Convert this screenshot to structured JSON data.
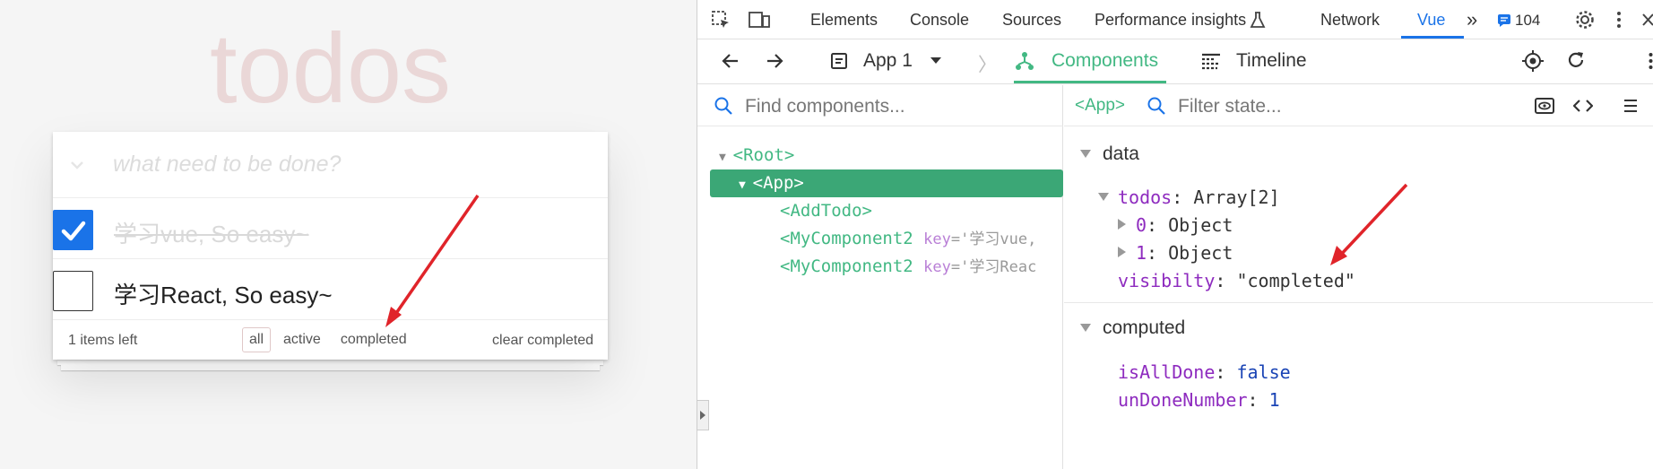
{
  "todo_app": {
    "title": "todos",
    "new_todo_placeholder": "what need to be done?",
    "items": [
      {
        "label": "学习vue, So easy~",
        "completed": true
      },
      {
        "label": "学习React, So easy~",
        "completed": false
      }
    ],
    "footer": {
      "items_left": "1 items left",
      "filters": [
        "all",
        "active",
        "completed"
      ],
      "selected_filter": "all",
      "clear_completed": "clear completed"
    }
  },
  "devtools": {
    "tabs": [
      "Elements",
      "Console",
      "Sources",
      "Performance insights",
      "Network",
      "Vue"
    ],
    "active_tab": "Vue",
    "message_count": "104",
    "app_selector": "App 1",
    "subtabs": [
      "Components",
      "Timeline"
    ],
    "active_subtab": "Components",
    "find_placeholder": "Find components...",
    "filter_placeholder": "Filter state...",
    "selected_component": "<App>",
    "tree": [
      {
        "label": "<Root>",
        "depth": 0,
        "expanded": true
      },
      {
        "label": "<App>",
        "depth": 1,
        "expanded": true,
        "selected": true
      },
      {
        "label": "<AddTodo>",
        "depth": 2
      },
      {
        "label": "<MyComponent2",
        "key_attr": "key",
        "key_value": "='学习vue,",
        "depth": 2
      },
      {
        "label": "<MyComponent2",
        "key_attr": "key",
        "key_value": "='学习Reac",
        "depth": 2
      }
    ],
    "state": {
      "data_title": "data",
      "todos_prop": "todos",
      "todos_value": "Array[2]",
      "todo_entries": [
        {
          "index": "0",
          "value": "Object"
        },
        {
          "index": "1",
          "value": "Object"
        }
      ],
      "visibility_prop": "visibilty",
      "visibility_value": "\"completed\"",
      "computed_title": "computed",
      "isAllDone_prop": "isAllDone",
      "isAllDone_value": "false",
      "unDoneNumber_prop": "unDoneNumber",
      "unDoneNumber_value": "1"
    }
  },
  "colors": {
    "vue_green": "#42b883",
    "annotation_red": "#e0242a",
    "accent_blue": "#1a73e8"
  }
}
